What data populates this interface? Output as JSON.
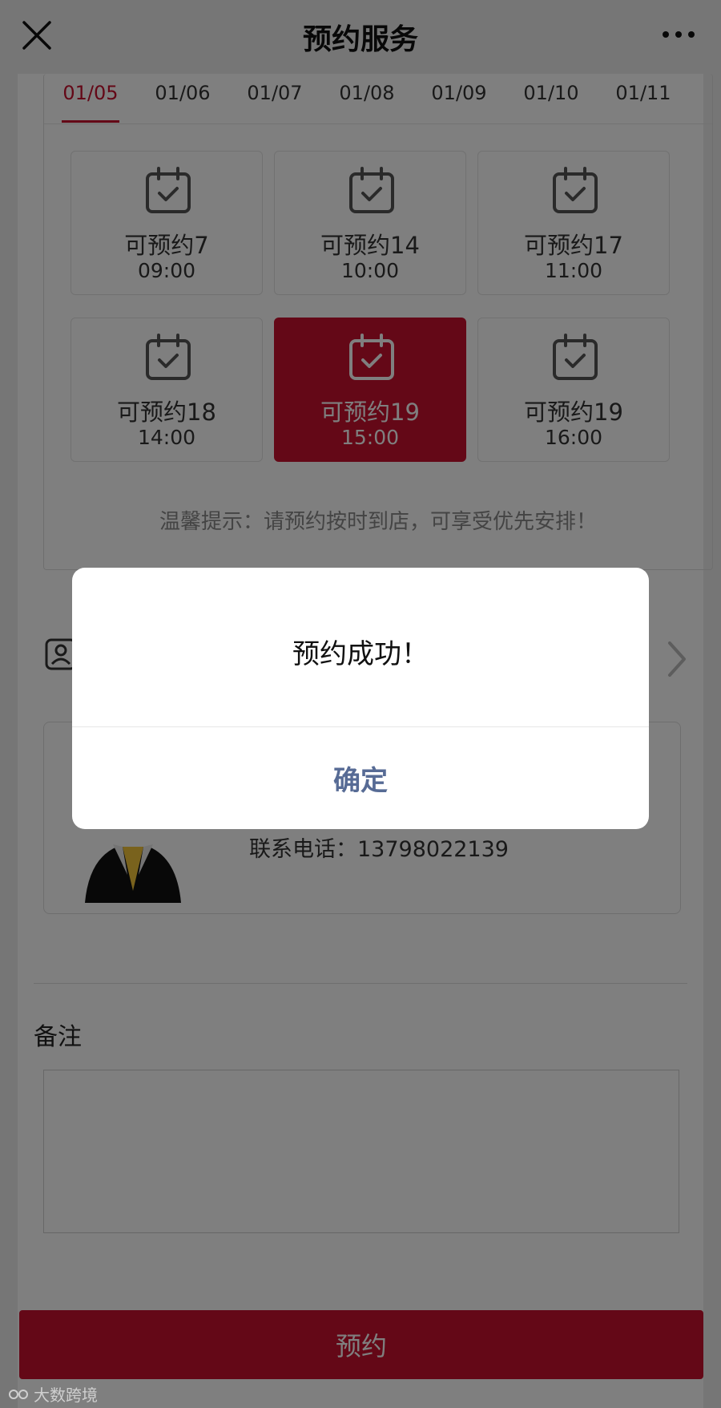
{
  "nav": {
    "title": "预约服务",
    "close_icon": "close-icon",
    "more_icon": "more-icon"
  },
  "date_tabs": [
    {
      "label": "01/05",
      "active": true
    },
    {
      "label": "01/06",
      "active": false
    },
    {
      "label": "01/07",
      "active": false
    },
    {
      "label": "01/08",
      "active": false
    },
    {
      "label": "01/09",
      "active": false
    },
    {
      "label": "01/10",
      "active": false
    },
    {
      "label": "01/11",
      "active": false
    }
  ],
  "slots": [
    {
      "count_label": "可预约7",
      "time": "09:00",
      "selected": false
    },
    {
      "count_label": "可预约14",
      "time": "10:00",
      "selected": false
    },
    {
      "count_label": "可预约17",
      "time": "11:00",
      "selected": false
    },
    {
      "count_label": "可预约18",
      "time": "14:00",
      "selected": false
    },
    {
      "count_label": "可预约19",
      "time": "15:00",
      "selected": true
    },
    {
      "count_label": "可预约19",
      "time": "16:00",
      "selected": false
    }
  ],
  "tip": "温馨提示：请预约按时到店，可享受优先安排！",
  "profile": {
    "phone": "联系电话：13798022139"
  },
  "remark": {
    "label": "备注",
    "value": ""
  },
  "book_button": "预约",
  "dialog": {
    "message": "预约成功！",
    "confirm": "确定"
  },
  "watermark": "大数跨境",
  "colors": {
    "accent": "#c8102e",
    "dialog_link": "#576b95",
    "overlay": "rgba(0,0,0,0.5)"
  }
}
